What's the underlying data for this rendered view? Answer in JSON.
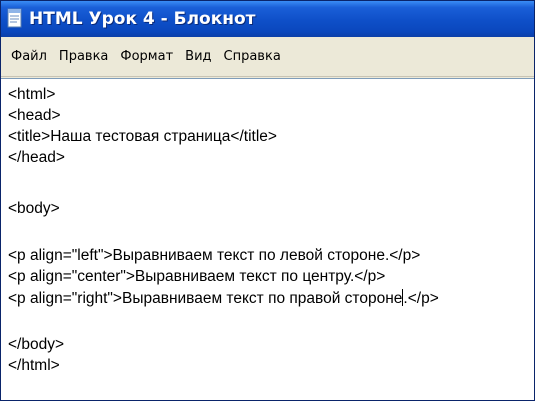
{
  "window": {
    "title": "HTML Урок 4 - Блокнот",
    "icon": "notepad-icon"
  },
  "menu": {
    "items": [
      "Файл",
      "Правка",
      "Формат",
      "Вид",
      "Справка"
    ]
  },
  "editor": {
    "lines": [
      "<html>",
      "<head>",
      "<title>Наша тестовая страница</title>",
      "</head>",
      "",
      "<body>",
      "",
      "<p align=\"left\">Выравниваем текст по левой стороне.</p>",
      "<p align=\"center\">Выравниваем текст по центру.</p>",
      "<p align=\"right\">Выравниваем текст по правой стороне",
      "",
      "</body>",
      "</html>"
    ],
    "caret_line_tail": ".</p>"
  },
  "colors": {
    "titlebar": "#0e4fc8",
    "menubar": "#ece9d8",
    "editor_bg": "#ffffff"
  }
}
